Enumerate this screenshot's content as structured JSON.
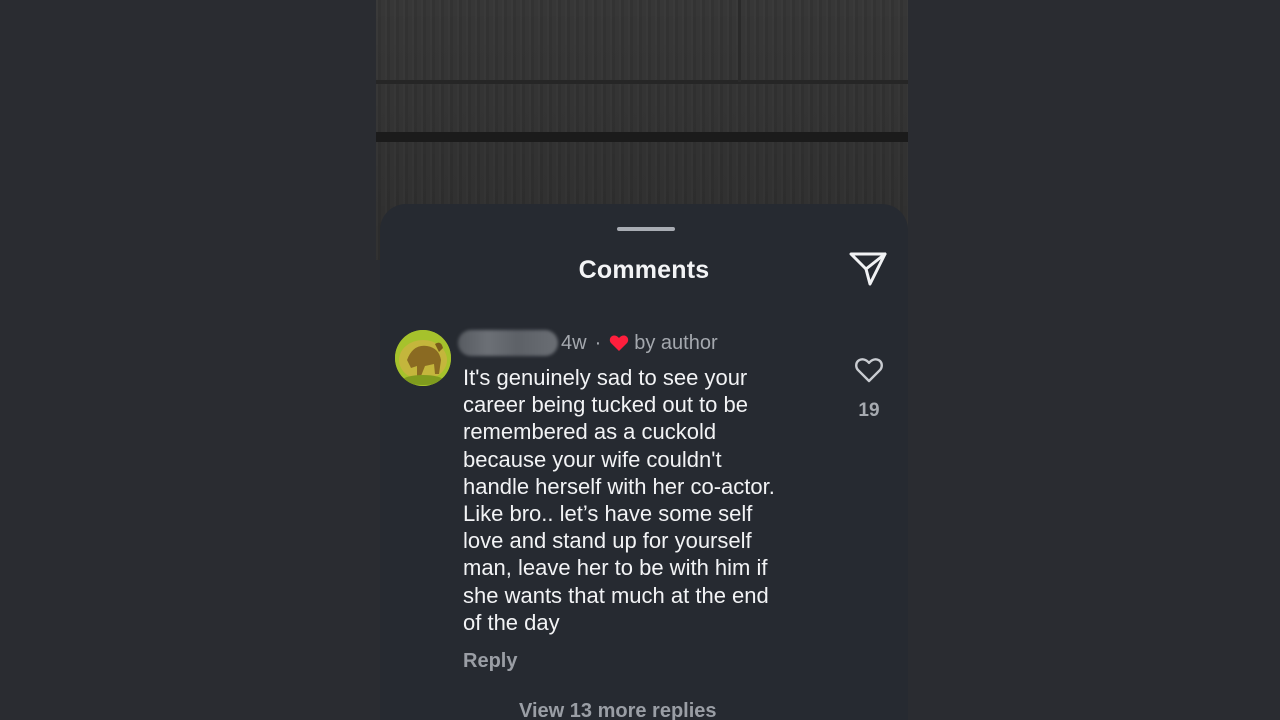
{
  "sheet": {
    "title": "Comments"
  },
  "comment": {
    "time": "4w",
    "separator": "·",
    "liked_by": "by author",
    "text": "It's genuinely sad to see your\ncareer being tucked out to be\nremembered as a cuckold\nbecause your wife couldn't\nhandle herself with her co-actor.\nLike bro.. let’s have some self\nlove and stand up for yourself\nman, leave her to be with him if\nshe wants that much at the end\nof the day",
    "reply_label": "Reply",
    "like_count": "19",
    "view_more_label": "View 13 more replies"
  },
  "icons": {
    "send": "paper-plane-icon",
    "like": "heart-outline-icon",
    "author_like": "heart-filled-icon"
  },
  "colors": {
    "sheet_bg": "#262a31",
    "page_bg": "#2a2c31",
    "heart_red": "#ff1f3d",
    "text_primary": "#f2f3f5",
    "text_secondary": "#a4a8ae"
  }
}
